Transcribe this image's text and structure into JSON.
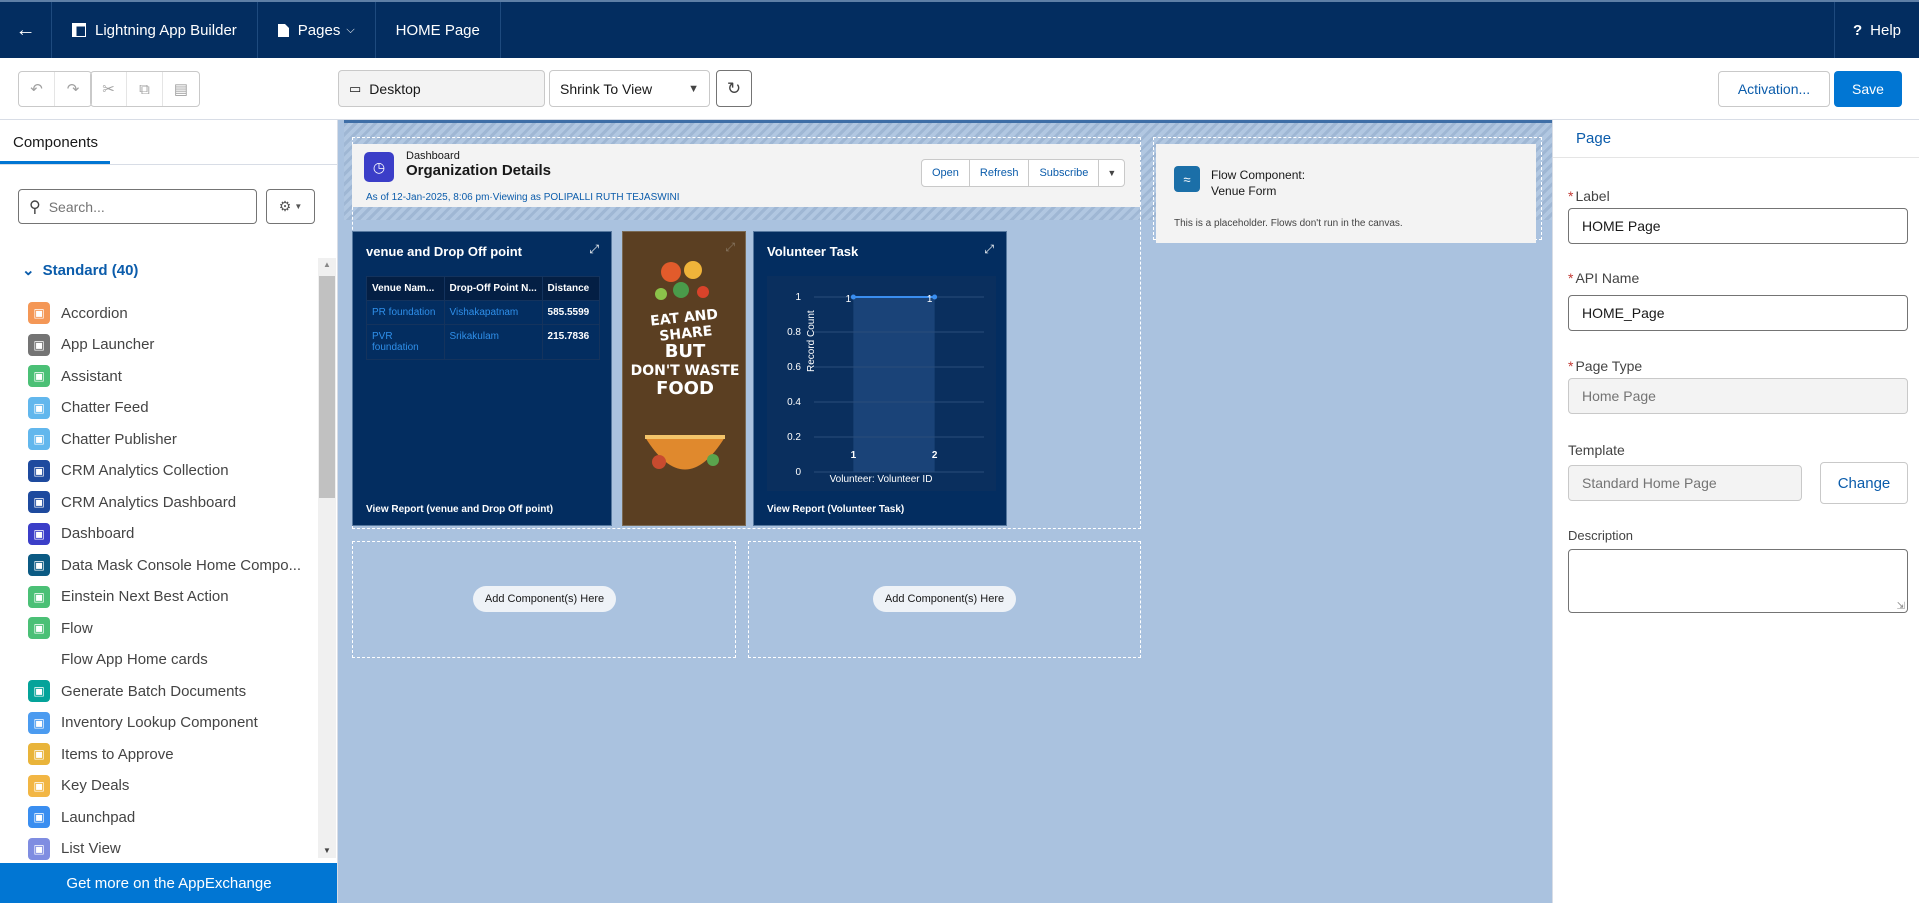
{
  "header": {
    "app_name": "Lightning App Builder",
    "pages_label": "Pages",
    "page_name": "HOME Page",
    "help_label": "Help"
  },
  "toolbar": {
    "device": "Desktop",
    "view_mode": "Shrink To View",
    "activation_label": "Activation...",
    "save_label": "Save"
  },
  "left_panel": {
    "tab_label": "Components",
    "search_placeholder": "Search...",
    "section_label": "Standard (40)",
    "components": [
      {
        "label": "Accordion",
        "color": "#f49756"
      },
      {
        "label": "App Launcher",
        "color": "#747474"
      },
      {
        "label": "Assistant",
        "color": "#4bc076"
      },
      {
        "label": "Chatter Feed",
        "color": "#62b7ed"
      },
      {
        "label": "Chatter Publisher",
        "color": "#62b7ed"
      },
      {
        "label": "CRM Analytics Collection",
        "color": "#1e4a9e"
      },
      {
        "label": "CRM Analytics Dashboard",
        "color": "#1e4a9e"
      },
      {
        "label": "Dashboard",
        "color": "#3b3ec8"
      },
      {
        "label": "Data Mask Console Home Compo...",
        "color": "#0b5a83"
      },
      {
        "label": "Einstein Next Best Action",
        "color": "#4bc076"
      },
      {
        "label": "Flow",
        "color": "#4bc076"
      },
      {
        "label": "Flow App Home cards",
        "color": ""
      },
      {
        "label": "Generate Batch Documents",
        "color": "#04a39a"
      },
      {
        "label": "Inventory Lookup Component",
        "color": "#4b9bf0"
      },
      {
        "label": "Items to Approve",
        "color": "#e9b43a"
      },
      {
        "label": "Key Deals",
        "color": "#f2b644"
      },
      {
        "label": "Launchpad",
        "color": "#3a8ef0"
      },
      {
        "label": "List View",
        "color": "#7f8de1"
      }
    ],
    "appexchange_label": "Get more on the AppExchange"
  },
  "canvas": {
    "dashboard": {
      "type_label": "Dashboard",
      "title": "Organization Details",
      "subtitle": "As of 12-Jan-2025, 8:06 pm·Viewing as POLIPALLI RUTH TEJASWINI",
      "buttons": [
        "Open",
        "Refresh",
        "Subscribe"
      ]
    },
    "venue_card": {
      "title": "venue and Drop Off point",
      "columns": [
        "Venue Nam...",
        "Drop-Off Point N...",
        "Distance"
      ],
      "rows": [
        [
          "PR foundation",
          "Vishakapatnam",
          "585.5599"
        ],
        [
          "PVR foundation",
          "Srikakulam",
          "215.7836"
        ]
      ],
      "report_link": "View Report (venue and Drop Off point)"
    },
    "poster_lines": [
      "EAT AND SHARE",
      "BUT",
      "DON'T WASTE",
      "FOOD"
    ],
    "volunteer_card": {
      "title": "Volunteer Task",
      "report_link": "View Report (Volunteer Task)"
    },
    "flow": {
      "title_line1": "Flow Component:",
      "title_line2": "Venue Form",
      "note": "This is a placeholder. Flows don't run in the canvas."
    },
    "add_component_label": "Add Component(s) Here"
  },
  "chart_data": {
    "type": "line",
    "title": "Volunteer Task",
    "x": [
      1,
      2
    ],
    "series": [
      {
        "values": [
          1,
          1
        ]
      }
    ],
    "data_labels": [
      "1",
      "1"
    ],
    "xlabel": "Volunteer: Volunteer ID",
    "ylabel": "Record Count",
    "yticks": [
      "0",
      "0.2",
      "0.4",
      "0.6",
      "0.8",
      "1"
    ],
    "ylim": [
      0,
      1
    ],
    "grid": true
  },
  "right_panel": {
    "title": "Page",
    "label_label": "Label",
    "label_value": "HOME Page",
    "api_label": "API Name",
    "api_value": "HOME_Page",
    "type_label": "Page Type",
    "type_value": "Home Page",
    "template_label": "Template",
    "template_value": "Standard Home Page",
    "change_label": "Change",
    "description_label": "Description"
  }
}
